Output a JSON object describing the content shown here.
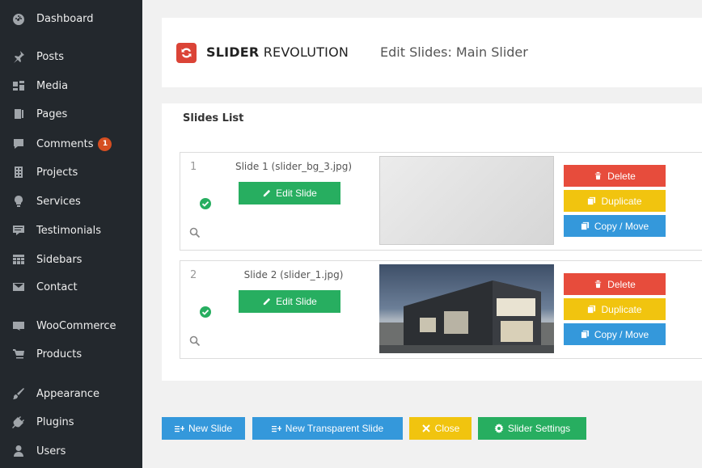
{
  "sidebar": {
    "items": [
      {
        "label": "Dashboard",
        "icon": "dashboard-icon"
      },
      {
        "label": "Posts",
        "icon": "pin-icon"
      },
      {
        "label": "Media",
        "icon": "media-icon"
      },
      {
        "label": "Pages",
        "icon": "pages-icon"
      },
      {
        "label": "Comments",
        "icon": "comment-icon",
        "badge": "1"
      },
      {
        "label": "Projects",
        "icon": "building-icon"
      },
      {
        "label": "Services",
        "icon": "lightbulb-icon"
      },
      {
        "label": "Testimonials",
        "icon": "testimonial-icon"
      },
      {
        "label": "Sidebars",
        "icon": "grid-icon"
      },
      {
        "label": "Contact",
        "icon": "mail-icon"
      },
      {
        "label": "WooCommerce",
        "icon": "woocommerce-icon"
      },
      {
        "label": "Products",
        "icon": "cart-icon"
      },
      {
        "label": "Appearance",
        "icon": "brush-icon"
      },
      {
        "label": "Plugins",
        "icon": "plug-icon"
      },
      {
        "label": "Users",
        "icon": "user-icon"
      }
    ]
  },
  "header": {
    "logo_bold": "SLIDER",
    "logo_rest": " REVOLUTION",
    "title": "Edit Slides: Main Slider"
  },
  "slides_list": {
    "title": "Slides List",
    "slides": [
      {
        "number": "1",
        "name": "Slide 1 (slider_bg_3.jpg)",
        "edit_label": "Edit Slide",
        "delete_label": "Delete",
        "duplicate_label": "Duplicate",
        "copy_label": "Copy / Move"
      },
      {
        "number": "2",
        "name": "Slide 2 (slider_1.jpg)",
        "edit_label": "Edit Slide",
        "delete_label": "Delete",
        "duplicate_label": "Duplicate",
        "copy_label": "Copy / Move"
      }
    ]
  },
  "footer_buttons": {
    "new_slide": "New Slide",
    "new_transparent_slide": "New Transparent Slide",
    "close": "Close",
    "slider_settings": "Slider Settings"
  },
  "colors": {
    "sidebar_bg": "#23282d",
    "green": "#27ae60",
    "red": "#e74c3c",
    "yellow": "#f1c40f",
    "blue": "#3498db",
    "brand_red": "#db4437"
  }
}
